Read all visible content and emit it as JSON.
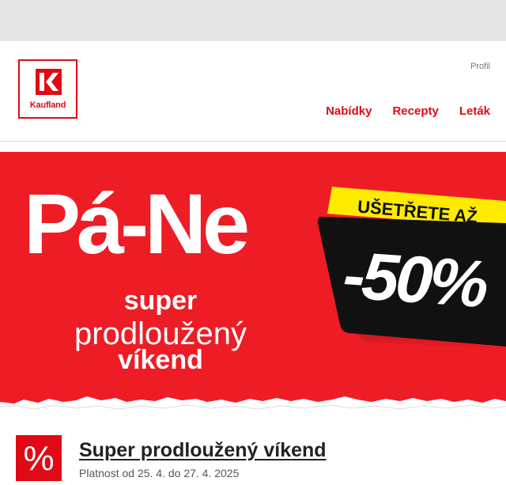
{
  "header": {
    "logo_text": "Kaufland",
    "profile_label": "Profil",
    "nav": [
      {
        "label": "Nabídky"
      },
      {
        "label": "Recepty"
      },
      {
        "label": "Leták"
      }
    ]
  },
  "banner": {
    "headline": "Pá-Ne",
    "sub_line_1": "super",
    "sub_line_2": "prodloužený",
    "sub_line_3": "víkend",
    "badge_label": "UŠETŘETE AŽ",
    "badge_value": "-50%"
  },
  "offer": {
    "icon_symbol": "%",
    "title": "Super prodloužený víkend",
    "validity": "Platnost od 25. 4. do 27. 4. 2025"
  },
  "colors": {
    "brand_red": "#e10915",
    "banner_red": "#ee1c25",
    "badge_yellow": "#ffeb00",
    "top_strip": "#e6e6e6"
  }
}
